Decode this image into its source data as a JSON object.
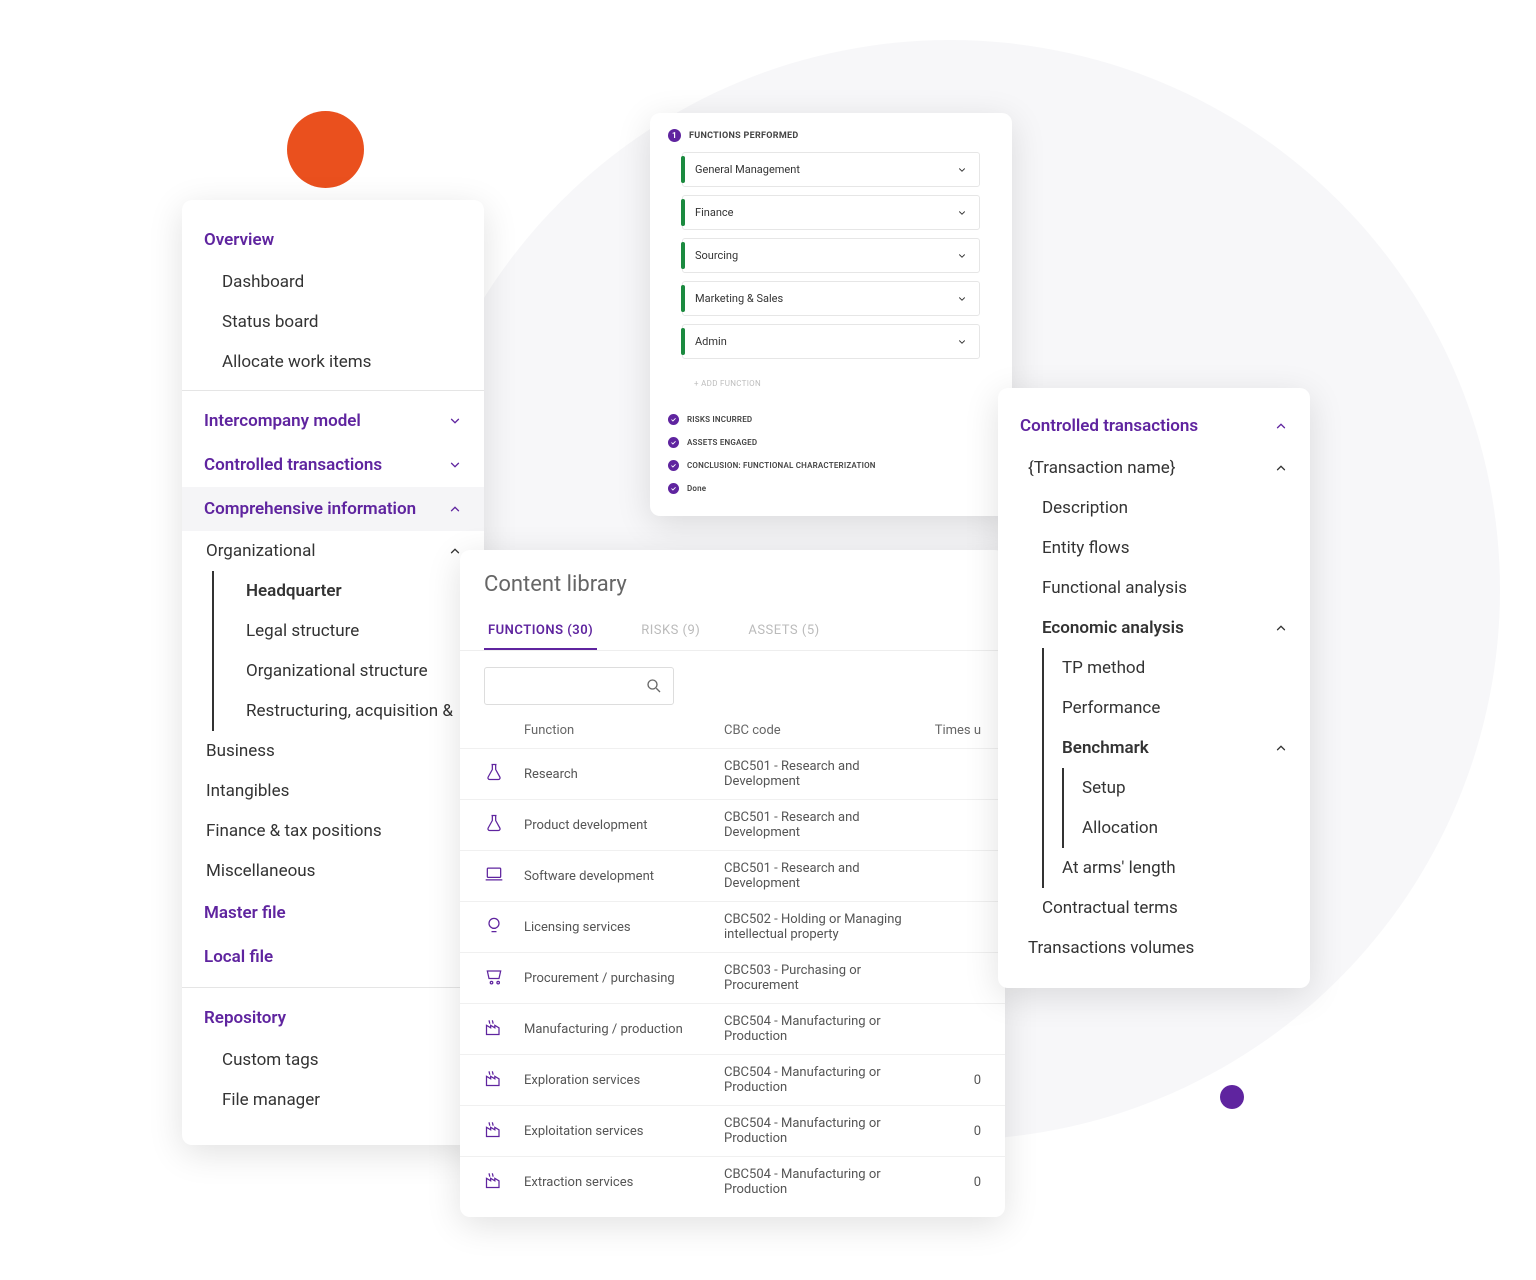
{
  "nav": {
    "overview": "Overview",
    "dashboard": "Dashboard",
    "status_board": "Status board",
    "allocate": "Allocate work items",
    "intercompany": "Intercompany model",
    "controlled": "Controlled transactions",
    "comprehensive": "Comprehensive information",
    "organizational": "Organizational",
    "hq": "Headquarter",
    "legal": "Legal structure",
    "org_struct": "Organizational structure",
    "restructuring": "Restructuring, acquisition &",
    "business": "Business",
    "intangibles": "Intangibles",
    "fin_tax": "Finance & tax positions",
    "misc": "Miscellaneous",
    "master_file": "Master file",
    "local_file": "Local file",
    "repository": "Repository",
    "custom_tags": "Custom tags",
    "file_manager": "File manager"
  },
  "fp": {
    "title": "FUNCTIONS PERFORMED",
    "items": [
      "General Management",
      "Finance",
      "Sourcing",
      "Marketing & Sales",
      "Admin"
    ],
    "add": "+   ADD FUNCTION",
    "risks": "RISKS INCURRED",
    "assets": "ASSETS ENGAGED",
    "conclusion": "CONCLUSION: FUNCTIONAL CHARACTERIZATION",
    "done": "Done"
  },
  "library": {
    "title": "Content library",
    "tabs": {
      "functions": "FUNCTIONS (30)",
      "risks": "RISKS (9)",
      "assets": "ASSETS (5)"
    },
    "head": {
      "fn": "Function",
      "code": "CBC code",
      "times": "Times u"
    },
    "rows": [
      {
        "icon": "flask",
        "fn": "Research",
        "code": "CBC501 - Research and Development",
        "times": ""
      },
      {
        "icon": "flask",
        "fn": "Product development",
        "code": "CBC501 - Research and Development",
        "times": ""
      },
      {
        "icon": "laptop",
        "fn": "Software development",
        "code": "CBC501 - Research and Development",
        "times": ""
      },
      {
        "icon": "bulb",
        "fn": "Licensing services",
        "code": "CBC502 - Holding or Managing intellectual property",
        "times": ""
      },
      {
        "icon": "cart",
        "fn": "Procurement / purchasing",
        "code": "CBC503 - Purchasing or Procurement",
        "times": ""
      },
      {
        "icon": "factory",
        "fn": "Manufacturing / production",
        "code": "CBC504 - Manufacturing or Production",
        "times": ""
      },
      {
        "icon": "factory",
        "fn": "Exploration services",
        "code": "CBC504 - Manufacturing or Production",
        "times": "0"
      },
      {
        "icon": "factory",
        "fn": "Exploitation services",
        "code": "CBC504 - Manufacturing or Production",
        "times": "0"
      },
      {
        "icon": "factory",
        "fn": "Extraction services",
        "code": "CBC504 - Manufacturing or Production",
        "times": "0"
      }
    ]
  },
  "ct": {
    "title": "Controlled transactions",
    "tx_name": "{Transaction name}",
    "description": "Description",
    "entity_flows": "Entity flows",
    "functional": "Functional analysis",
    "economic": "Economic analysis",
    "tp_method": "TP method",
    "performance": "Performance",
    "benchmark": "Benchmark",
    "setup": "Setup",
    "allocation": "Allocation",
    "arms_length": "At arms' length",
    "contractual": "Contractual terms",
    "volumes": "Transactions volumes"
  }
}
